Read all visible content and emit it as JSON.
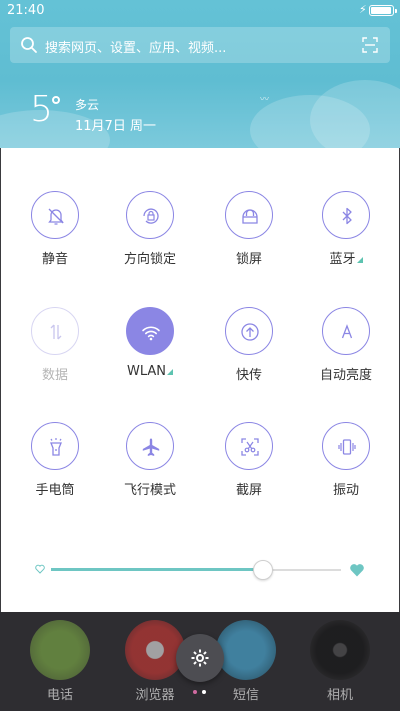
{
  "status_bar": {
    "time": "21:40",
    "battery_level": 0.95
  },
  "search": {
    "placeholder": "搜索网页、设置、应用、视频..."
  },
  "weather": {
    "temperature": "5",
    "condition": "多云",
    "date": "11月7日 周一"
  },
  "toggles": [
    {
      "label": "静音",
      "icon": "bell-off-icon",
      "state": "off"
    },
    {
      "label": "方向锁定",
      "icon": "rotation-lock-icon",
      "state": "off"
    },
    {
      "label": "锁屏",
      "icon": "lock-icon",
      "state": "off"
    },
    {
      "label": "蓝牙",
      "icon": "bluetooth-icon",
      "state": "off",
      "has_more": true
    },
    {
      "label": "数据",
      "icon": "mobile-data-icon",
      "state": "disabled"
    },
    {
      "label": "WLAN",
      "icon": "wifi-icon",
      "state": "on",
      "has_more": true
    },
    {
      "label": "快传",
      "icon": "quick-transfer-icon",
      "state": "off"
    },
    {
      "label": "自动亮度",
      "icon": "auto-brightness-icon",
      "state": "off"
    },
    {
      "label": "手电筒",
      "icon": "flashlight-icon",
      "state": "off"
    },
    {
      "label": "飞行模式",
      "icon": "airplane-icon",
      "state": "off"
    },
    {
      "label": "截屏",
      "icon": "screenshot-icon",
      "state": "off"
    },
    {
      "label": "振动",
      "icon": "vibrate-icon",
      "state": "off"
    }
  ],
  "brightness": {
    "value": 0.73
  },
  "dock": {
    "apps": [
      {
        "label": "电话",
        "icon": "phone-icon",
        "color": "#8bc34a"
      },
      {
        "label": "浏览器",
        "icon": "browser-icon",
        "color": "#e53935"
      },
      {
        "label": "短信",
        "icon": "messages-icon",
        "color": "#29b6f6"
      },
      {
        "label": "相机",
        "icon": "camera-icon",
        "color": "#111111"
      }
    ],
    "page_indicator": {
      "count": 2,
      "current": 2
    }
  },
  "colors": {
    "accent": "#8b86e4",
    "sky": "#62c0d5",
    "brightness_fill": "#6ec6c3",
    "more_marker": "#5dc3b0"
  }
}
